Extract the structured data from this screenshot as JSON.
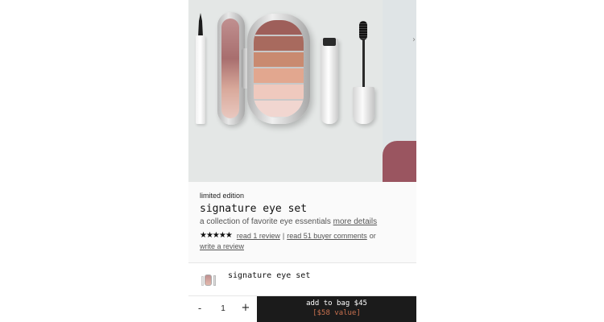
{
  "product": {
    "badge": "limited edition",
    "title": "signature eye set",
    "description": "a collection of favorite eye essentials",
    "details_link": "more details",
    "rating_stars": "★★★★★",
    "rating_value": 5,
    "read_reviews": "read 1 review",
    "separator": "|",
    "read_comments": "read 51 buyer comments",
    "or_text": "or",
    "write_review": "write a review"
  },
  "included": {
    "item_name": "signature eye set",
    "thumbnail_icon": "product-thumbnail-icon"
  },
  "purchase": {
    "minus": "-",
    "quantity": "1",
    "plus": "+",
    "add_label": "add to bag $45",
    "value_label": "[$58 value]"
  },
  "nav": {
    "next_icon": "›"
  },
  "colors": {
    "cart_bg": "#1b1b1b",
    "value_accent": "#c9714f",
    "palette_shades": [
      "#9e5f5a",
      "#a86a5e",
      "#c98a70",
      "#e2a78f",
      "#efc9be",
      "#f1d6d0"
    ]
  }
}
